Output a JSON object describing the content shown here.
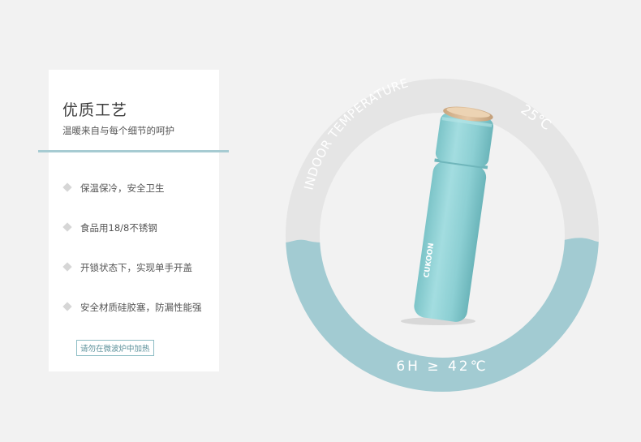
{
  "panel": {
    "title": "优质工艺",
    "subtitle": "温暖来自与每个细节的呵护",
    "features": [
      "保温保冷，安全卫生",
      "食品用18/8不锈钢",
      "开锁状态下，实现单手开盖",
      "安全材质硅胶塞，防漏性能强"
    ],
    "warning": "请勿在微波炉中加热"
  },
  "ring": {
    "arc_text": "INDOOR TEMPERATURE",
    "indoor_temp": "25℃",
    "keep_warm": "6H ≥ 42℃",
    "upper_color": "#e5e5e5",
    "lower_color": "#a2cbd2"
  },
  "bottle": {
    "brand": "CUKOON",
    "body_color": "#8fd0d4",
    "cap_color": "#d9b895"
  }
}
